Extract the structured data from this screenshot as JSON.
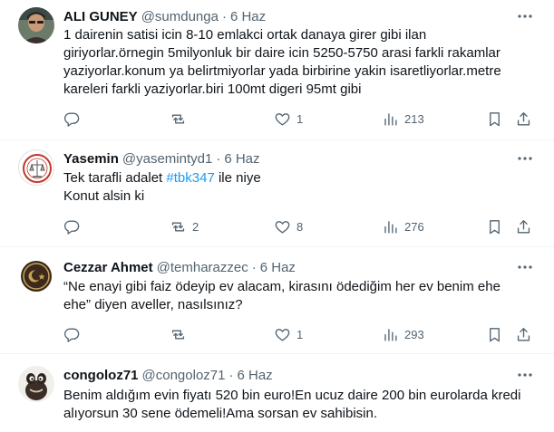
{
  "tweets": [
    {
      "name": "ALI GUNEY",
      "handle": "@sumdunga",
      "separator": "·",
      "time": "6 Haz",
      "lines": [
        "1 dairenin satisi icin  8-10 emlakci ortak danaya girer gibi ilan",
        "giriyorlar.örnegin 5milyonluk bir daire icin 5250-5750 arasi farkli rakamlar",
        "yaziyorlar.konum ya belirtmiyorlar yada birbirine yakin isaretliyorlar.metre",
        "kareleri farkli yaziyorlar.biri 100mt digeri 95mt gibi"
      ],
      "replies": "",
      "retweets": "",
      "likes": "1",
      "views": "213"
    },
    {
      "name": "Yasemin",
      "handle": "@yasemintyd1",
      "separator": "·",
      "time": "6 Haz",
      "line1_before": "Tek tarafli adalet ",
      "hashtag": "#tbk347",
      "line1_after": " ile niye",
      "line2": "Konut alsin ki",
      "replies": "",
      "retweets": "2",
      "likes": "8",
      "views": "276"
    },
    {
      "name": "Cezzar Ahmet",
      "handle": "@temharazzec",
      "separator": "·",
      "time": "6 Haz",
      "lines": [
        "“Ne enayi gibi faiz ödeyip ev alacam, kirasını ödediğim her ev benim ehe",
        "ehe” diyen aveller, nasılsınız?"
      ],
      "replies": "",
      "retweets": "",
      "likes": "1",
      "views": "293"
    },
    {
      "name": "congoloz71",
      "handle": "@congoloz71",
      "separator": "·",
      "time": "6 Haz",
      "lines": [
        "Benim aldığım evin fiyatı 520 bin euro!En ucuz daire 200 bin eurolarda kredi",
        "alıyorsun 30 sene ödemeli!Ama sorsan ev sahibisin."
      ]
    }
  ]
}
